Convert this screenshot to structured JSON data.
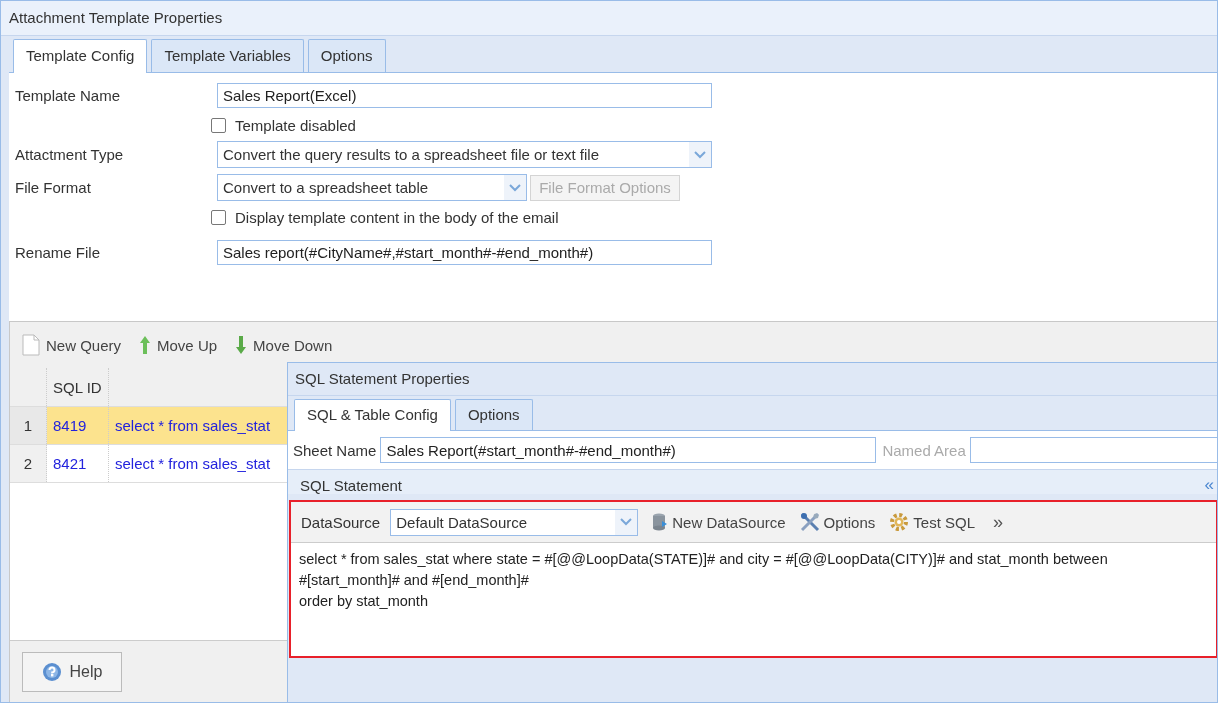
{
  "window": {
    "title": "Attachment Template Properties"
  },
  "tabs": [
    {
      "label": "Template Config",
      "selected": true
    },
    {
      "label": "Template Variables",
      "selected": false
    },
    {
      "label": "Options",
      "selected": false
    }
  ],
  "form": {
    "template_name": {
      "label": "Template Name",
      "value": "Sales Report(Excel)"
    },
    "template_disabled": {
      "label": "Template disabled",
      "checked": false
    },
    "attachment_type": {
      "label": "Attactment Type",
      "value": "Convert the query results to a spreadsheet file or text file"
    },
    "file_format": {
      "label": "File Format",
      "value": "Convert to a spreadsheet table",
      "options_button": {
        "label": "File Format Options",
        "disabled": true
      }
    },
    "display_in_body": {
      "label": "Display template content in the body of the email",
      "checked": false
    },
    "rename_file": {
      "label": "Rename File",
      "value": "Sales report(#CityName#,#start_month#-#end_month#)"
    }
  },
  "toolbar": [
    {
      "label": "New Query",
      "kind": "new"
    },
    {
      "label": "Move Up",
      "kind": "up"
    },
    {
      "label": "Move Down",
      "kind": "down"
    }
  ],
  "grid": {
    "columns": [
      "SQL ID"
    ],
    "rows": [
      {
        "number": "1",
        "sql_id": "8419",
        "sql": "select * from sales_stat",
        "selected": true
      },
      {
        "number": "2",
        "sql_id": "8421",
        "sql": "select * from sales_stat",
        "selected": false
      }
    ]
  },
  "help_button": "Help",
  "sql_window": {
    "title": "SQL Statement Properties",
    "tabs": [
      {
        "label": "SQL & Table Config",
        "selected": true
      },
      {
        "label": "Options",
        "selected": false
      }
    ],
    "sheet_name": {
      "label": "Sheet Name",
      "value": "Sales Report(#start_month#-#end_month#)"
    },
    "named_area": {
      "label": "Named Area",
      "disabled": true
    },
    "section": {
      "title": "SQL Statement",
      "collapse": "«"
    },
    "datasource": {
      "label": "DataSource",
      "value": "Default DataSource"
    },
    "buttons": [
      {
        "label": "New DataSource",
        "kind": "db"
      },
      {
        "label": "Options",
        "kind": "tools"
      },
      {
        "label": "Test SQL",
        "kind": "gear"
      }
    ],
    "more": "»",
    "sql_text": "select * from sales_stat where state = #[@@LoopData(STATE)]# and city = #[@@LoopData(CITY)]# and stat_month between\n#[start_month]# and #[end_month]#\norder by stat_month",
    "highlighted": true
  }
}
